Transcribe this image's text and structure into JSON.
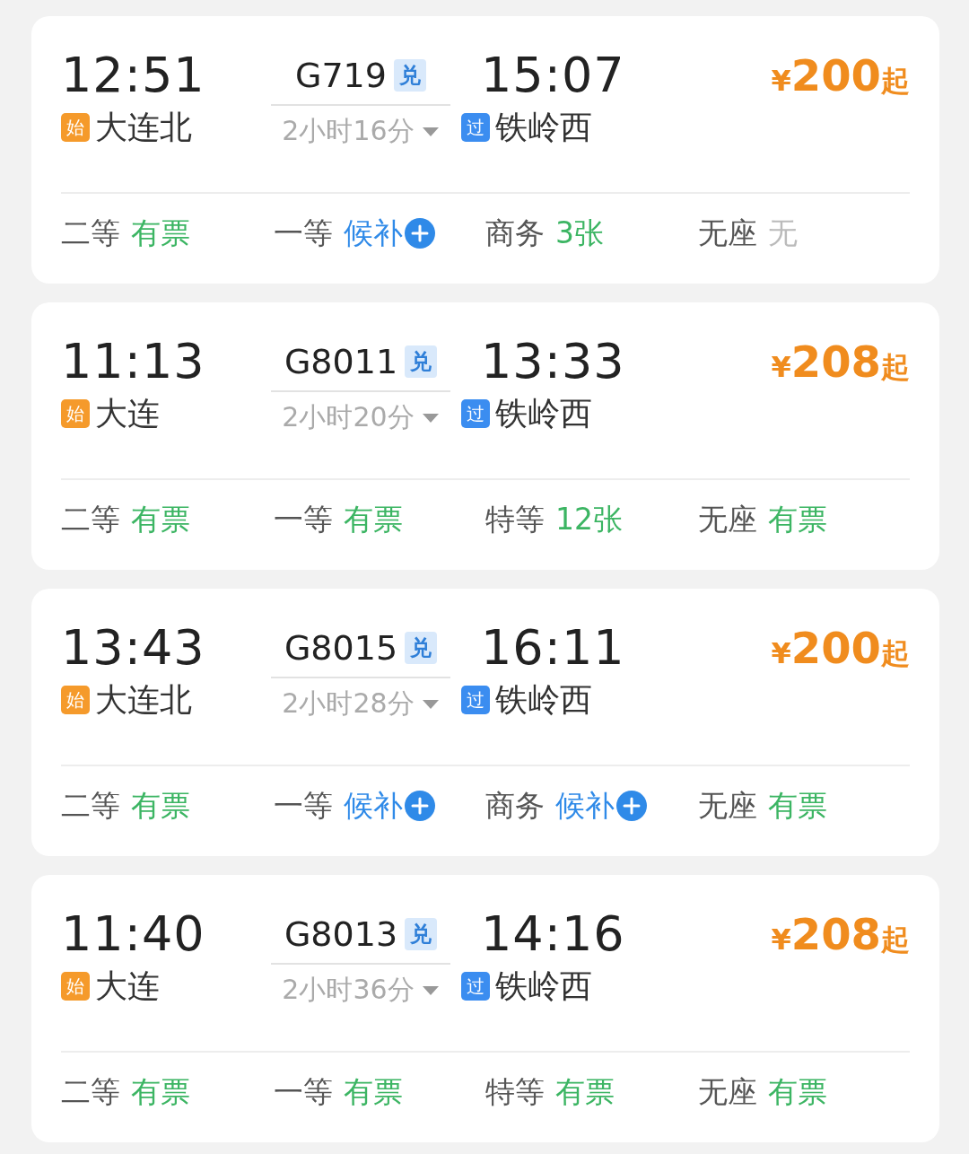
{
  "trains": [
    {
      "depart_time": "12:51",
      "origin_badge": "始",
      "origin": "大连北",
      "train_no": "G719",
      "train_badge": "兑",
      "duration": "2小时16分",
      "arrive_time": "15:07",
      "dest_badge": "过",
      "destination": "铁岭西",
      "price_symbol": "¥",
      "price": "200",
      "price_suffix": "起",
      "seats": [
        {
          "class": "二等",
          "status": "有票",
          "kind": "available"
        },
        {
          "class": "一等",
          "status": "候补",
          "kind": "waitlist"
        },
        {
          "class": "商务",
          "status": "3张",
          "kind": "available"
        },
        {
          "class": "无座",
          "status": "无",
          "kind": "none"
        }
      ]
    },
    {
      "depart_time": "11:13",
      "origin_badge": "始",
      "origin": "大连",
      "train_no": "G8011",
      "train_badge": "兑",
      "duration": "2小时20分",
      "arrive_time": "13:33",
      "dest_badge": "过",
      "destination": "铁岭西",
      "price_symbol": "¥",
      "price": "208",
      "price_suffix": "起",
      "seats": [
        {
          "class": "二等",
          "status": "有票",
          "kind": "available"
        },
        {
          "class": "一等",
          "status": "有票",
          "kind": "available"
        },
        {
          "class": "特等",
          "status": "12张",
          "kind": "available"
        },
        {
          "class": "无座",
          "status": "有票",
          "kind": "available"
        }
      ]
    },
    {
      "depart_time": "13:43",
      "origin_badge": "始",
      "origin": "大连北",
      "train_no": "G8015",
      "train_badge": "兑",
      "duration": "2小时28分",
      "arrive_time": "16:11",
      "dest_badge": "过",
      "destination": "铁岭西",
      "price_symbol": "¥",
      "price": "200",
      "price_suffix": "起",
      "seats": [
        {
          "class": "二等",
          "status": "有票",
          "kind": "available"
        },
        {
          "class": "一等",
          "status": "候补",
          "kind": "waitlist"
        },
        {
          "class": "商务",
          "status": "候补",
          "kind": "waitlist"
        },
        {
          "class": "无座",
          "status": "有票",
          "kind": "available"
        }
      ]
    },
    {
      "depart_time": "11:40",
      "origin_badge": "始",
      "origin": "大连",
      "train_no": "G8013",
      "train_badge": "兑",
      "duration": "2小时36分",
      "arrive_time": "14:16",
      "dest_badge": "过",
      "destination": "铁岭西",
      "price_symbol": "¥",
      "price": "208",
      "price_suffix": "起",
      "seats": [
        {
          "class": "二等",
          "status": "有票",
          "kind": "available"
        },
        {
          "class": "一等",
          "status": "有票",
          "kind": "available"
        },
        {
          "class": "特等",
          "status": "有票",
          "kind": "available"
        },
        {
          "class": "无座",
          "status": "有票",
          "kind": "available"
        }
      ]
    }
  ]
}
